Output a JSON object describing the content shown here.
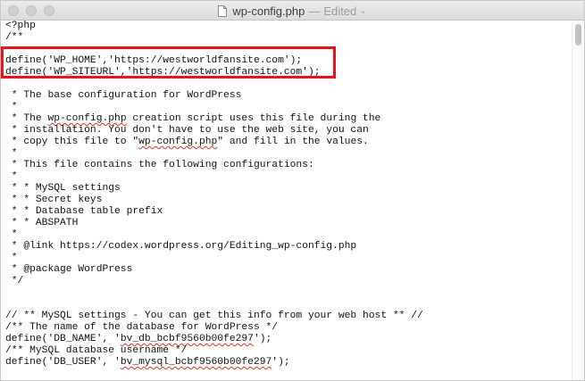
{
  "window": {
    "filename": "wp-config.php",
    "separator": "—",
    "status": "Edited",
    "chevron": "⌄"
  },
  "editor": {
    "lines": [
      "<?php",
      "/**",
      "",
      "define('WP_HOME','https://westworldfansite.com');",
      "define('WP_SITEURL','https://westworldfansite.com');",
      "",
      " * The base configuration for WordPress",
      " *",
      " * The wp-config.php creation script uses this file during the",
      " * installation. You don't have to use the web site, you can",
      " * copy this file to \"wp-config.php\" and fill in the values.",
      " *",
      " * This file contains the following configurations:",
      " *",
      " * * MySQL settings",
      " * * Secret keys",
      " * * Database table prefix",
      " * * ABSPATH",
      " *",
      " * @link https://codex.wordpress.org/Editing_wp-config.php",
      " *",
      " * @package WordPress",
      " */",
      "",
      "",
      "// ** MySQL settings - You can get this info from your web host ** //",
      "/** The name of the database for WordPress */",
      "define('DB_NAME', 'bv_db_bcbf9560b00fe297');",
      "/** MySQL database username */",
      "define('DB_USER', 'bv_mysql_bcbf9560b00fe297');"
    ]
  }
}
